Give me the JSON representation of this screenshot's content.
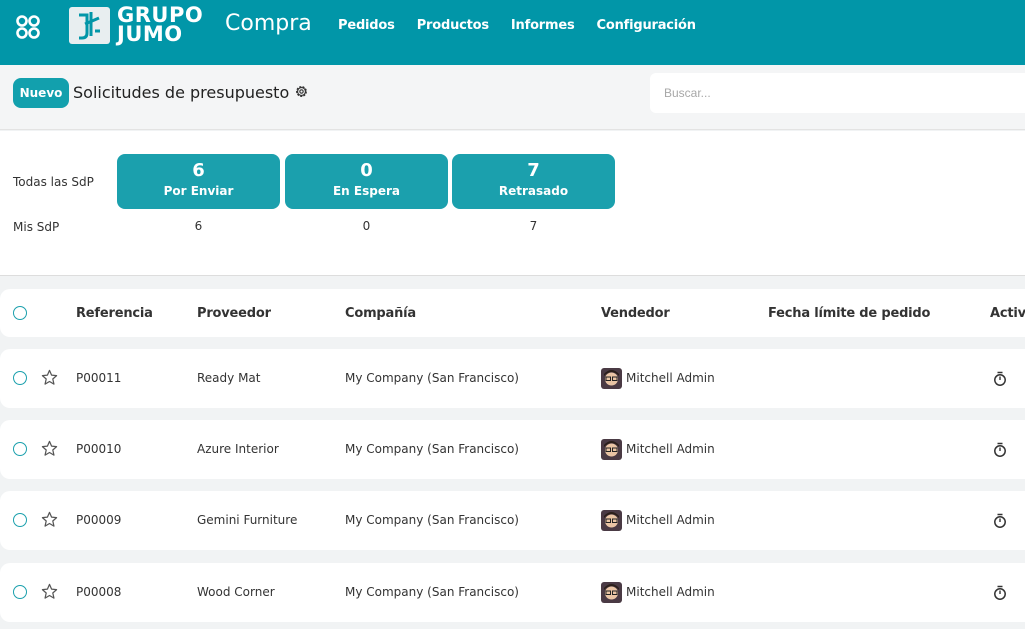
{
  "brand": {
    "line1": "GRUPO",
    "line2": "JUMO"
  },
  "app_title": "Compra",
  "nav": [
    "Pedidos",
    "Productos",
    "Informes",
    "Configuración"
  ],
  "control": {
    "new_label": "Nuevo",
    "page_title": "Solicitudes de presupuesto",
    "search_placeholder": "Buscar..."
  },
  "dashboard": {
    "all_label": "Todas las SdP",
    "mine_label": "Mis SdP",
    "tiles": [
      {
        "count": "6",
        "label": "Por Enviar",
        "mine": "6"
      },
      {
        "count": "0",
        "label": "En Espera",
        "mine": "0"
      },
      {
        "count": "7",
        "label": "Retrasado",
        "mine": "7"
      }
    ]
  },
  "table": {
    "headers": [
      "Referencia",
      "Proveedor",
      "Compañía",
      "Vendedor",
      "Fecha límite de pedido",
      "Activi"
    ],
    "rows": [
      {
        "ref": "P00011",
        "vendor": "Ready Mat",
        "company": "My Company (San Francisco)",
        "salesperson": "Mitchell Admin"
      },
      {
        "ref": "P00010",
        "vendor": "Azure Interior",
        "company": "My Company (San Francisco)",
        "salesperson": "Mitchell Admin"
      },
      {
        "ref": "P00009",
        "vendor": "Gemini Furniture",
        "company": "My Company (San Francisco)",
        "salesperson": "Mitchell Admin"
      },
      {
        "ref": "P00008",
        "vendor": "Wood Corner",
        "company": "My Company (San Francisco)",
        "salesperson": "Mitchell Admin"
      }
    ]
  },
  "colors": {
    "topbar": "#0196a8",
    "accent": "#1ba0ad"
  },
  "icons": [
    "apps-grid-icon",
    "gear-icon",
    "star-icon",
    "clock-icon"
  ]
}
